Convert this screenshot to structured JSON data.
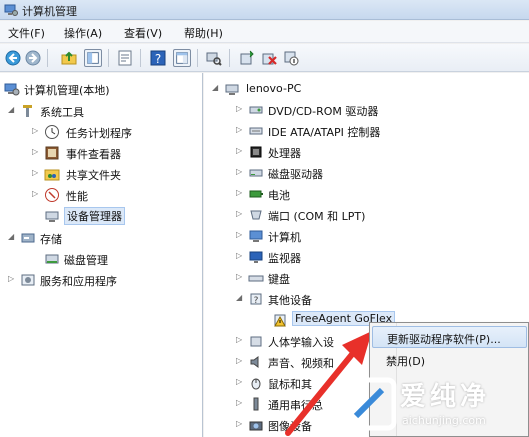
{
  "window": {
    "title": "计算机管理"
  },
  "menu": [
    {
      "label": "文件(F)"
    },
    {
      "label": "操作(A)"
    },
    {
      "label": "查看(V)"
    },
    {
      "label": "帮助(H)"
    }
  ],
  "toolbar": {
    "buttons": [
      "back-icon",
      "forward-icon",
      "up-folder-icon",
      "show-hide-tree-icon",
      "properties-icon",
      "help-icon",
      "console-icon",
      "scan-hardware-icon",
      "update-driver-icon",
      "uninstall-icon",
      "disable-icon"
    ]
  },
  "left_tree": [
    {
      "label": "计算机管理(本地)",
      "expanded": true
    },
    {
      "label": "系统工具",
      "expanded": true
    },
    {
      "label": "任务计划程序",
      "expanded": false
    },
    {
      "label": "事件查看器",
      "expanded": false
    },
    {
      "label": "共享文件夹",
      "expanded": false
    },
    {
      "label": "性能",
      "expanded": false
    },
    {
      "label": "设备管理器",
      "selected": true
    },
    {
      "label": "存储",
      "expanded": true
    },
    {
      "label": "磁盘管理"
    },
    {
      "label": "服务和应用程序",
      "expanded": false
    }
  ],
  "right_tree": {
    "root": "lenovo-PC",
    "items": [
      {
        "label": "DVD/CD-ROM 驱动器",
        "icon": "dvd-drive-icon"
      },
      {
        "label": "IDE ATA/ATAPI 控制器",
        "icon": "ide-controller-icon"
      },
      {
        "label": "处理器",
        "icon": "processor-icon"
      },
      {
        "label": "磁盘驱动器",
        "icon": "disk-drive-icon"
      },
      {
        "label": "电池",
        "icon": "battery-icon"
      },
      {
        "label": "端口 (COM 和 LPT)",
        "icon": "port-icon"
      },
      {
        "label": "计算机",
        "icon": "computer-icon"
      },
      {
        "label": "监视器",
        "icon": "monitor-icon"
      },
      {
        "label": "键盘",
        "icon": "keyboard-icon"
      },
      {
        "label": "其他设备",
        "icon": "other-devices-icon",
        "expanded": true
      },
      {
        "label": "FreeAgent GoFlex",
        "icon": "warning-device-icon",
        "selected": true
      },
      {
        "label": "人体学输入设",
        "icon": "hid-icon"
      },
      {
        "label": "声音、视频和",
        "icon": "sound-icon"
      },
      {
        "label": "鼠标和其",
        "icon": "mouse-icon"
      },
      {
        "label": "通用串行总",
        "icon": "usb-icon"
      },
      {
        "label": "图像设备",
        "icon": "imaging-icon"
      }
    ]
  },
  "context_menu": {
    "items": [
      {
        "label": "更新驱动程序软件(P)...",
        "highlighted": true
      },
      {
        "label": "禁用(D)"
      }
    ]
  },
  "watermark": {
    "brand": "爱纯净",
    "url": "aichunjing.com"
  },
  "colors": {
    "selection": "#dbe8f8",
    "arrow": "#e8302a",
    "pane_border": "#b9c4d2"
  }
}
